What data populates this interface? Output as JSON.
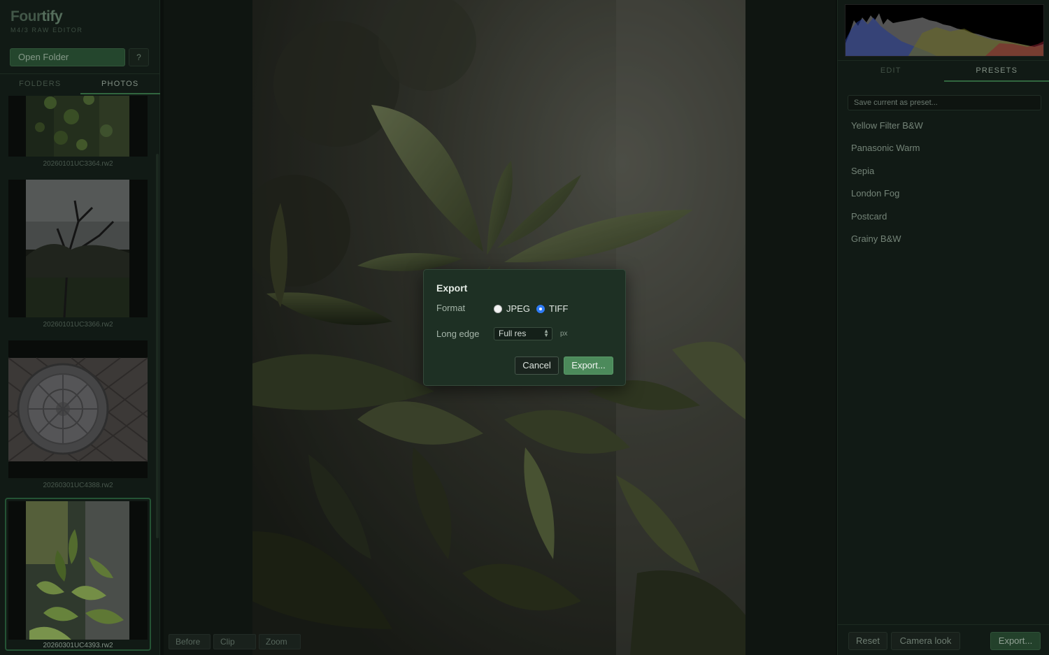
{
  "app": {
    "name_part1": "Four",
    "name_part2": "tify",
    "subtitle": "M4/3 RAW EDITOR"
  },
  "sidebar": {
    "open_folder_label": "Open Folder",
    "help_label": "?",
    "tabs": [
      {
        "label": "FOLDERS"
      },
      {
        "label": "PHOTOS",
        "active": true
      }
    ],
    "photos": [
      {
        "filename": "20260101UC3364.rw2"
      },
      {
        "filename": "20260101UC3366.rw2"
      },
      {
        "filename": "20260301UC4388.rw2"
      },
      {
        "filename": "20260301UC4393.rw2",
        "selected": true
      }
    ]
  },
  "viewer": {
    "buttons": [
      {
        "label": "Before"
      },
      {
        "label": "Clip"
      },
      {
        "label": "Zoom"
      }
    ]
  },
  "right_panel": {
    "tabs": [
      {
        "label": "EDIT"
      },
      {
        "label": "PRESETS",
        "active": true
      }
    ],
    "preset_placeholder": "Save current as preset...",
    "presets": [
      {
        "label": "Yellow Filter B&W"
      },
      {
        "label": "Panasonic Warm"
      },
      {
        "label": "Sepia"
      },
      {
        "label": "London Fog"
      },
      {
        "label": "Postcard"
      },
      {
        "label": "Grainy B&W"
      }
    ],
    "footer": {
      "reset_label": "Reset",
      "camera_label": "Camera look",
      "export_label": "Export..."
    }
  },
  "dialog": {
    "title": "Export",
    "format_label": "Format",
    "format_options": [
      {
        "label": "JPEG"
      },
      {
        "label": "TIFF",
        "checked": true
      }
    ],
    "long_edge_label": "Long edge",
    "long_edge_value": "Full res",
    "unit": "px",
    "cancel_label": "Cancel",
    "export_label": "Export..."
  },
  "colors": {
    "accent": "#3f8351",
    "primary_button": "#4c8a5b",
    "radio_checked": "#2f7cf6",
    "panel_bg": "#17221b"
  },
  "icons": {
    "select_arrows": "chevron-updown-icon"
  }
}
